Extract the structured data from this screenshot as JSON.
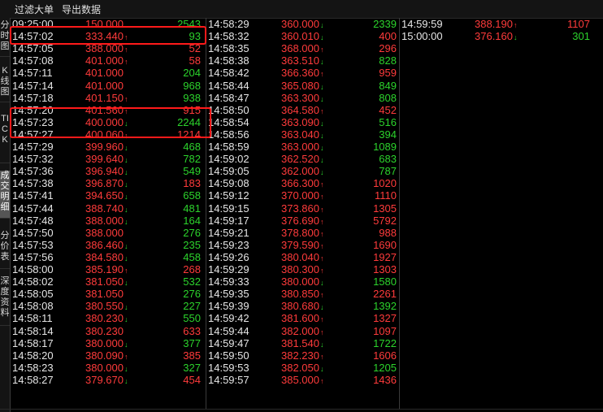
{
  "toolbar": {
    "filter_label": "过滤大单",
    "export_label": "导出数据"
  },
  "side_tabs": [
    {
      "label": "分时图",
      "active": false
    },
    {
      "label": "K线图",
      "active": false
    },
    {
      "label": "TICK",
      "active": false
    },
    {
      "label": "成交明细",
      "active": true
    },
    {
      "label": "分价表",
      "active": false
    },
    {
      "label": "深度资料",
      "active": false
    }
  ],
  "colors": {
    "up": "#ff3b3b",
    "down": "#2cd32c",
    "highlight": "#ff1a1a"
  },
  "columns": [
    {
      "rows": [
        {
          "time": "09:25:00",
          "price": "150.000",
          "dir": "",
          "vol": "2543",
          "vol_dir": "down"
        },
        {
          "time": "14:57:02",
          "price": "333.440",
          "dir": "up",
          "vol": "93",
          "vol_dir": "down"
        },
        {
          "time": "14:57:05",
          "price": "388.000",
          "dir": "up",
          "vol": "52",
          "vol_dir": "up"
        },
        {
          "time": "14:57:08",
          "price": "401.000",
          "dir": "up",
          "vol": "58",
          "vol_dir": "up"
        },
        {
          "time": "14:57:11",
          "price": "401.000",
          "dir": "",
          "vol": "204",
          "vol_dir": "down"
        },
        {
          "time": "14:57:14",
          "price": "401.000",
          "dir": "",
          "vol": "968",
          "vol_dir": "down"
        },
        {
          "time": "14:57:18",
          "price": "401.150",
          "dir": "up",
          "vol": "938",
          "vol_dir": "down"
        },
        {
          "time": "14:57:20",
          "price": "401.560",
          "dir": "up",
          "vol": "915",
          "vol_dir": "up"
        },
        {
          "time": "14:57:23",
          "price": "400.000",
          "dir": "down",
          "vol": "2244",
          "vol_dir": "down"
        },
        {
          "time": "14:57:27",
          "price": "400.060",
          "dir": "up",
          "vol": "1214",
          "vol_dir": "up"
        },
        {
          "time": "14:57:29",
          "price": "399.960",
          "dir": "down",
          "vol": "468",
          "vol_dir": "down"
        },
        {
          "time": "14:57:32",
          "price": "399.640",
          "dir": "down",
          "vol": "782",
          "vol_dir": "down"
        },
        {
          "time": "14:57:36",
          "price": "396.940",
          "dir": "down",
          "vol": "549",
          "vol_dir": "down"
        },
        {
          "time": "14:57:38",
          "price": "396.870",
          "dir": "down",
          "vol": "183",
          "vol_dir": "up"
        },
        {
          "time": "14:57:41",
          "price": "394.650",
          "dir": "down",
          "vol": "658",
          "vol_dir": "down"
        },
        {
          "time": "14:57:44",
          "price": "388.740",
          "dir": "down",
          "vol": "481",
          "vol_dir": "down"
        },
        {
          "time": "14:57:48",
          "price": "388.000",
          "dir": "down",
          "vol": "164",
          "vol_dir": "down"
        },
        {
          "time": "14:57:50",
          "price": "388.000",
          "dir": "",
          "vol": "276",
          "vol_dir": "down"
        },
        {
          "time": "14:57:53",
          "price": "386.460",
          "dir": "down",
          "vol": "235",
          "vol_dir": "down"
        },
        {
          "time": "14:57:56",
          "price": "384.580",
          "dir": "down",
          "vol": "458",
          "vol_dir": "down"
        },
        {
          "time": "14:58:00",
          "price": "385.190",
          "dir": "up",
          "vol": "268",
          "vol_dir": "up"
        },
        {
          "time": "14:58:02",
          "price": "381.050",
          "dir": "down",
          "vol": "532",
          "vol_dir": "down"
        },
        {
          "time": "14:58:05",
          "price": "381.050",
          "dir": "",
          "vol": "276",
          "vol_dir": "down"
        },
        {
          "time": "14:58:08",
          "price": "380.550",
          "dir": "down",
          "vol": "227",
          "vol_dir": "down"
        },
        {
          "time": "14:58:11",
          "price": "380.230",
          "dir": "down",
          "vol": "550",
          "vol_dir": "down"
        },
        {
          "time": "14:58:14",
          "price": "380.230",
          "dir": "",
          "vol": "633",
          "vol_dir": "up"
        },
        {
          "time": "14:58:17",
          "price": "380.000",
          "dir": "down",
          "vol": "377",
          "vol_dir": "down"
        },
        {
          "time": "14:58:20",
          "price": "380.090",
          "dir": "up",
          "vol": "385",
          "vol_dir": "up"
        },
        {
          "time": "14:58:23",
          "price": "380.000",
          "dir": "down",
          "vol": "327",
          "vol_dir": "down"
        },
        {
          "time": "14:58:27",
          "price": "379.670",
          "dir": "down",
          "vol": "454",
          "vol_dir": "up"
        }
      ]
    },
    {
      "rows": [
        {
          "time": "14:58:29",
          "price": "360.000",
          "dir": "down",
          "vol": "2339",
          "vol_dir": "down"
        },
        {
          "time": "14:58:32",
          "price": "360.010",
          "dir": "down",
          "vol": "400",
          "vol_dir": "up"
        },
        {
          "time": "14:58:35",
          "price": "368.000",
          "dir": "up",
          "vol": "296",
          "vol_dir": "up"
        },
        {
          "time": "14:58:38",
          "price": "363.510",
          "dir": "down",
          "vol": "828",
          "vol_dir": "down"
        },
        {
          "time": "14:58:42",
          "price": "366.360",
          "dir": "up",
          "vol": "959",
          "vol_dir": "up"
        },
        {
          "time": "14:58:44",
          "price": "365.080",
          "dir": "down",
          "vol": "849",
          "vol_dir": "down"
        },
        {
          "time": "14:58:47",
          "price": "363.300",
          "dir": "down",
          "vol": "808",
          "vol_dir": "down"
        },
        {
          "time": "14:58:50",
          "price": "364.580",
          "dir": "up",
          "vol": "452",
          "vol_dir": "up"
        },
        {
          "time": "14:58:54",
          "price": "363.090",
          "dir": "down",
          "vol": "516",
          "vol_dir": "down"
        },
        {
          "time": "14:58:56",
          "price": "363.040",
          "dir": "down",
          "vol": "394",
          "vol_dir": "down"
        },
        {
          "time": "14:58:59",
          "price": "363.000",
          "dir": "down",
          "vol": "1089",
          "vol_dir": "down"
        },
        {
          "time": "14:59:02",
          "price": "362.520",
          "dir": "down",
          "vol": "683",
          "vol_dir": "down"
        },
        {
          "time": "14:59:05",
          "price": "362.000",
          "dir": "down",
          "vol": "787",
          "vol_dir": "down"
        },
        {
          "time": "14:59:08",
          "price": "366.300",
          "dir": "up",
          "vol": "1020",
          "vol_dir": "up"
        },
        {
          "time": "14:59:12",
          "price": "370.000",
          "dir": "up",
          "vol": "1110",
          "vol_dir": "up"
        },
        {
          "time": "14:59:15",
          "price": "373.860",
          "dir": "up",
          "vol": "1305",
          "vol_dir": "up"
        },
        {
          "time": "14:59:17",
          "price": "376.690",
          "dir": "up",
          "vol": "5792",
          "vol_dir": "up"
        },
        {
          "time": "14:59:21",
          "price": "378.800",
          "dir": "up",
          "vol": "988",
          "vol_dir": "up"
        },
        {
          "time": "14:59:23",
          "price": "379.590",
          "dir": "up",
          "vol": "1690",
          "vol_dir": "up"
        },
        {
          "time": "14:59:26",
          "price": "380.040",
          "dir": "up",
          "vol": "1927",
          "vol_dir": "up"
        },
        {
          "time": "14:59:29",
          "price": "380.300",
          "dir": "up",
          "vol": "1303",
          "vol_dir": "up"
        },
        {
          "time": "14:59:33",
          "price": "380.000",
          "dir": "down",
          "vol": "1580",
          "vol_dir": "down"
        },
        {
          "time": "14:59:35",
          "price": "380.850",
          "dir": "up",
          "vol": "2261",
          "vol_dir": "up"
        },
        {
          "time": "14:59:39",
          "price": "380.680",
          "dir": "down",
          "vol": "1392",
          "vol_dir": "down"
        },
        {
          "time": "14:59:42",
          "price": "381.600",
          "dir": "up",
          "vol": "1327",
          "vol_dir": "up"
        },
        {
          "time": "14:59:44",
          "price": "382.000",
          "dir": "up",
          "vol": "1097",
          "vol_dir": "up"
        },
        {
          "time": "14:59:47",
          "price": "381.540",
          "dir": "down",
          "vol": "1722",
          "vol_dir": "down"
        },
        {
          "time": "14:59:50",
          "price": "382.230",
          "dir": "up",
          "vol": "1606",
          "vol_dir": "up"
        },
        {
          "time": "14:59:53",
          "price": "382.050",
          "dir": "down",
          "vol": "1205",
          "vol_dir": "down"
        },
        {
          "time": "14:59:57",
          "price": "385.000",
          "dir": "up",
          "vol": "1436",
          "vol_dir": "up"
        }
      ]
    },
    {
      "rows": [
        {
          "time": "14:59:59",
          "price": "388.190",
          "dir": "up",
          "vol": "1107",
          "vol_dir": "up"
        },
        {
          "time": "15:00:00",
          "price": "376.160",
          "dir": "down",
          "vol": "301",
          "vol_dir": "down"
        }
      ]
    }
  ]
}
